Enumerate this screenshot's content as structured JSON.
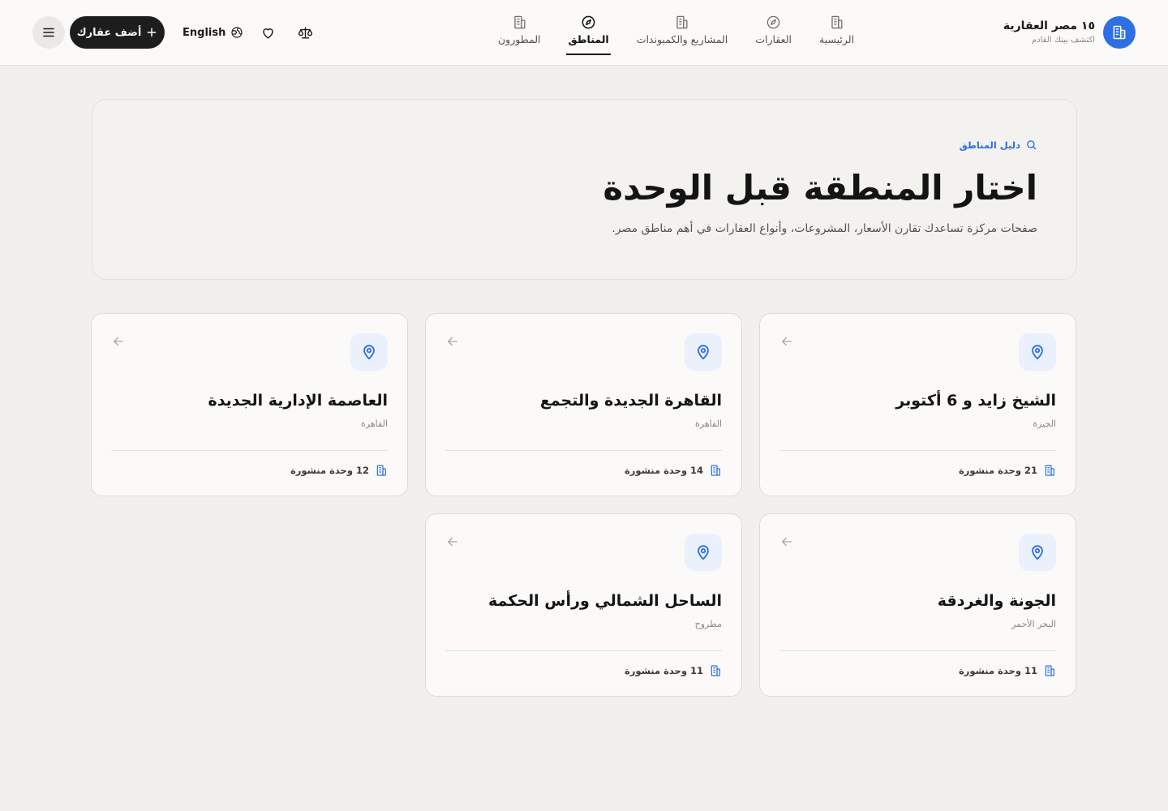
{
  "brand": {
    "name": "١٥ مصر العقارية",
    "tagline": "اكتشف بيتك القادم"
  },
  "nav": [
    {
      "label": "الرئيسية",
      "icon": "building-icon",
      "active": false
    },
    {
      "label": "العقارات",
      "icon": "compass-icon",
      "active": false
    },
    {
      "label": "المشاريع والكمبوندات",
      "icon": "building-icon",
      "active": false
    },
    {
      "label": "المناطق",
      "icon": "compass-icon",
      "active": true
    },
    {
      "label": "المطورون",
      "icon": "building-icon",
      "active": false
    }
  ],
  "actions": {
    "add_label": "أضف عقارك",
    "lang_label": "English"
  },
  "hero": {
    "kicker": "دليل المناطق",
    "title": "اختار المنطقة قبل الوحدة",
    "subtitle": "صفحات مركزة تساعدك تقارن الأسعار، المشروعات، وأنواع العقارات في أهم مناطق مصر."
  },
  "areas": [
    {
      "title": "الشيخ زايد و 6 أكتوبر",
      "governorate": "الجيزة",
      "count": "21 وحدة منشورة"
    },
    {
      "title": "القاهرة الجديدة والتجمع",
      "governorate": "القاهرة",
      "count": "14 وحدة منشورة"
    },
    {
      "title": "العاصمة الإدارية الجديدة",
      "governorate": "القاهرة",
      "count": "12 وحدة منشورة"
    },
    {
      "title": "الجونة والغردقة",
      "governorate": "البحر الأحمر",
      "count": "11 وحدة منشورة"
    },
    {
      "title": "الساحل الشمالي ورأس الحكمة",
      "governorate": "مطروح",
      "count": "11 وحدة منشورة"
    }
  ],
  "colors": {
    "accent": "#2f6fe4",
    "background": "#f1f0ed",
    "dark_button": "#1d1d1d"
  }
}
